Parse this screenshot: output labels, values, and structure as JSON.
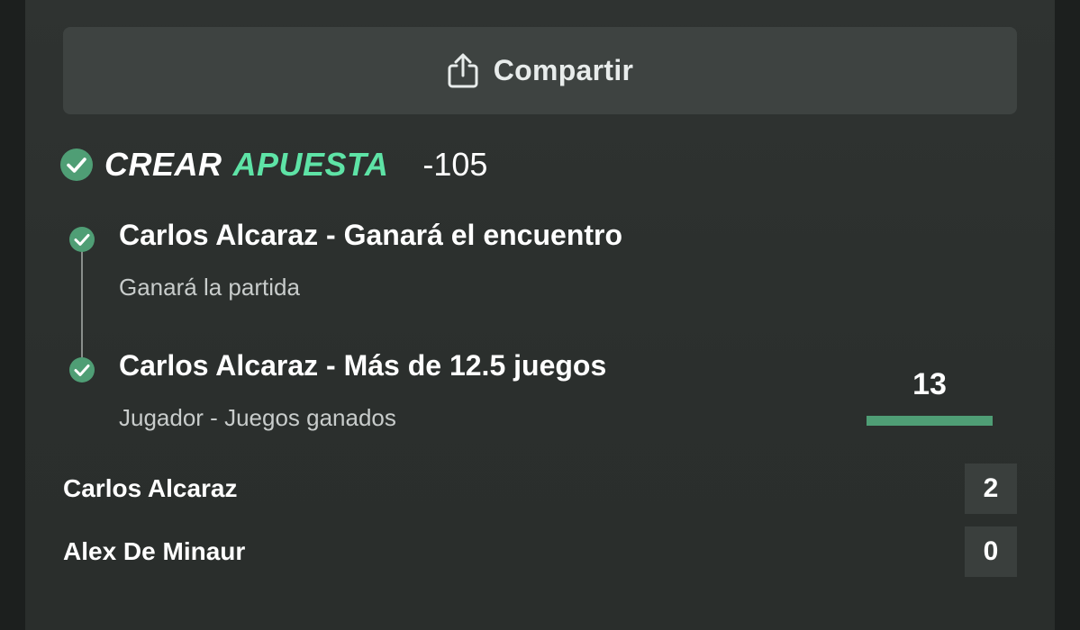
{
  "share": {
    "label": "Compartir",
    "icon": "share-icon"
  },
  "bet": {
    "title_part1": "CREAR",
    "title_part2": "APUESTA",
    "odds": "-105",
    "accent_color": "#5ee3a6",
    "check_color": "#4f9e75",
    "legs": [
      {
        "title": "Carlos Alcaraz - Ganará el encuentro",
        "subtitle": "Ganará la partida",
        "status": "won"
      },
      {
        "title": "Carlos Alcaraz - Más de 12.5 juegos",
        "subtitle": "Jugador - Juegos ganados",
        "status": "won",
        "progress_value": "13",
        "progress_fraction": 1.0
      }
    ]
  },
  "score": {
    "players": [
      {
        "name": "Carlos Alcaraz",
        "sets": "2"
      },
      {
        "name": "Alex De Minaur",
        "sets": "0"
      }
    ]
  }
}
